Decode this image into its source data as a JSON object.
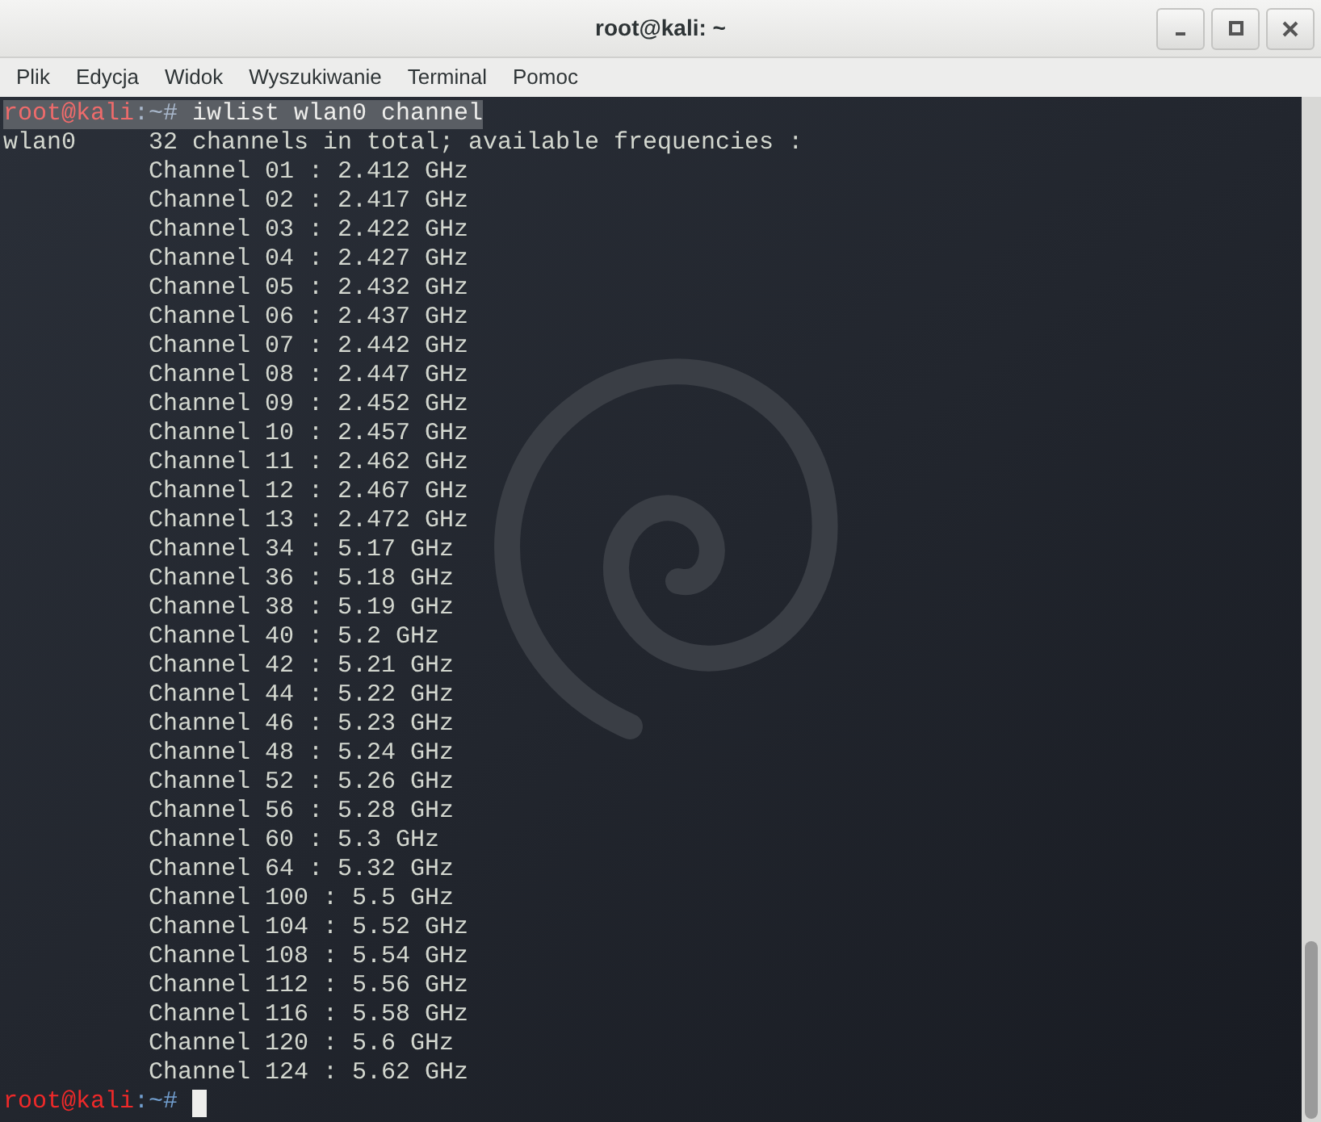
{
  "window": {
    "title": "root@kali: ~"
  },
  "menu": [
    "Plik",
    "Edycja",
    "Widok",
    "Wyszukiwanie",
    "Terminal",
    "Pomoc"
  ],
  "terminal": {
    "command_prompt": {
      "user_host": "root@kali",
      "path": ":~#",
      "command": " iwlist wlan0 channel",
      "selected": true
    },
    "interface": "wlan0",
    "summary": "32 channels in total; available frequencies :",
    "channels": [
      "Channel 01 : 2.412 GHz",
      "Channel 02 : 2.417 GHz",
      "Channel 03 : 2.422 GHz",
      "Channel 04 : 2.427 GHz",
      "Channel 05 : 2.432 GHz",
      "Channel 06 : 2.437 GHz",
      "Channel 07 : 2.442 GHz",
      "Channel 08 : 2.447 GHz",
      "Channel 09 : 2.452 GHz",
      "Channel 10 : 2.457 GHz",
      "Channel 11 : 2.462 GHz",
      "Channel 12 : 2.467 GHz",
      "Channel 13 : 2.472 GHz",
      "Channel 34 : 5.17 GHz",
      "Channel 36 : 5.18 GHz",
      "Channel 38 : 5.19 GHz",
      "Channel 40 : 5.2 GHz",
      "Channel 42 : 5.21 GHz",
      "Channel 44 : 5.22 GHz",
      "Channel 46 : 5.23 GHz",
      "Channel 48 : 5.24 GHz",
      "Channel 52 : 5.26 GHz",
      "Channel 56 : 5.28 GHz",
      "Channel 60 : 5.3 GHz",
      "Channel 64 : 5.32 GHz",
      "Channel 100 : 5.5 GHz",
      "Channel 104 : 5.52 GHz",
      "Channel 108 : 5.54 GHz",
      "Channel 112 : 5.56 GHz",
      "Channel 116 : 5.58 GHz",
      "Channel 120 : 5.6 GHz",
      "Channel 124 : 5.62 GHz"
    ],
    "final_prompt": {
      "user_host": "root@kali",
      "path": ":~#"
    }
  }
}
